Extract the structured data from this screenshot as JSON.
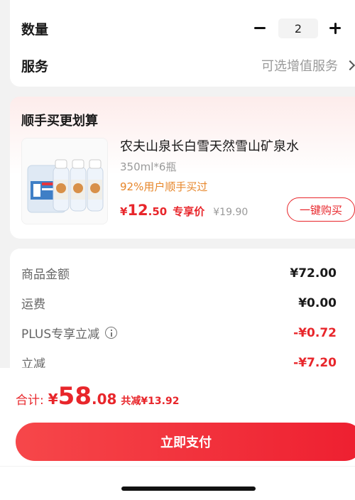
{
  "order": {
    "quantity_label": "数量",
    "quantity_value": "2",
    "service_label": "服务",
    "service_value": "可选增值服务"
  },
  "recommend": {
    "title": "顺手买更划算",
    "product": {
      "name": "农夫山泉长白雪天然雪山矿泉水",
      "spec": "350ml*6瓶",
      "buyers_text": "92%用户顺手买过",
      "price_symbol": "¥",
      "price_int": "12",
      "price_dec": ".50",
      "price_tag": "专享价",
      "original_price": "¥19.90",
      "buy_button": "一键购买",
      "image_icon": "water-bottle-pack"
    }
  },
  "amounts": {
    "rows": [
      {
        "label": "商品金额",
        "value": "¥72.00",
        "color": "#1a1a1a"
      },
      {
        "label": "运费",
        "value": "¥0.00",
        "color": "#1a1a1a"
      },
      {
        "label": "PLUS专享立减",
        "value": "-¥0.72",
        "color": "#e8262b",
        "icon": "info-icon"
      },
      {
        "label": "立减",
        "value": "-¥7.20",
        "color": "#e8262b"
      }
    ]
  },
  "footer": {
    "total_label": "合计:",
    "total_symbol": "¥",
    "total_int": "58",
    "total_dec": ".08",
    "discount_text": "共减¥13.92",
    "pay_button": "立即支付"
  },
  "colors": {
    "accent": "#e8262b",
    "promo_orange": "#e7862a",
    "muted": "#9a9a9a"
  }
}
